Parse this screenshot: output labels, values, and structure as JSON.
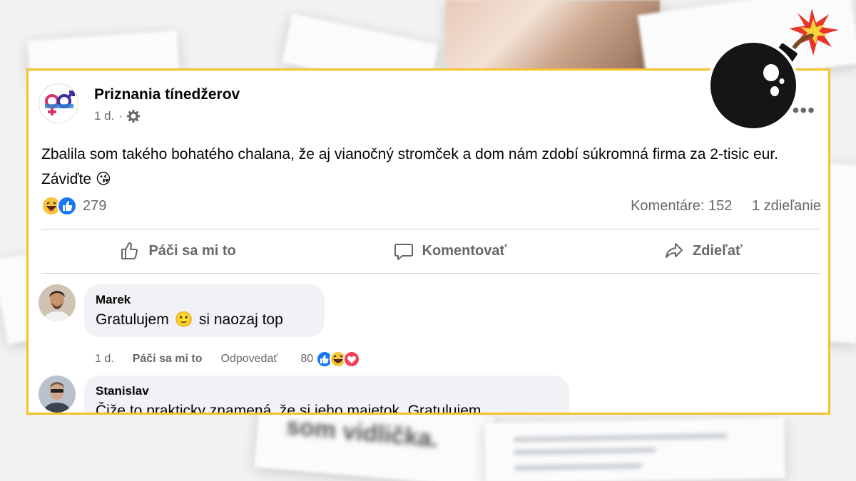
{
  "post": {
    "page_name": "Priznania tínedžerov",
    "time": "1 d.",
    "dot": "·",
    "privacy_icon": "gear-icon",
    "more_label": "•••",
    "text": "Zbalila som takého bohatého chalana, že aj vianočný stromček a dom nám zdobí súkromná firma za 2-tisic eur. Záviďte",
    "text_emoji": "😘",
    "reaction_icons": [
      "laughing-emoji-icon",
      "like-icon"
    ],
    "reaction_count": "279",
    "comments_count": "Komentáre: 152",
    "shares_count": "1 zdieľanie"
  },
  "actions": {
    "like": "Páči sa mi to",
    "comment": "Komentovať",
    "share": "Zdieľať"
  },
  "comments": [
    {
      "name": "Marek",
      "text_before": "Gratulujem",
      "emoji": "🙂",
      "text_after": "si naozaj top",
      "time": "1 d.",
      "like_label": "Páči sa mi to",
      "reply_label": "Odpovedať",
      "reaction_count": "80"
    },
    {
      "name": "Stanislav",
      "text": "Čiže to prakticky znamená, že si jeho majetok. Gratulujem"
    }
  ],
  "background": {
    "blurred_text": "som vidlička."
  },
  "colors": {
    "frame": "#f5c22b",
    "facebook_blue": "#1877f2",
    "bubble": "#f0f2f5",
    "secondary_text": "#65676b"
  }
}
